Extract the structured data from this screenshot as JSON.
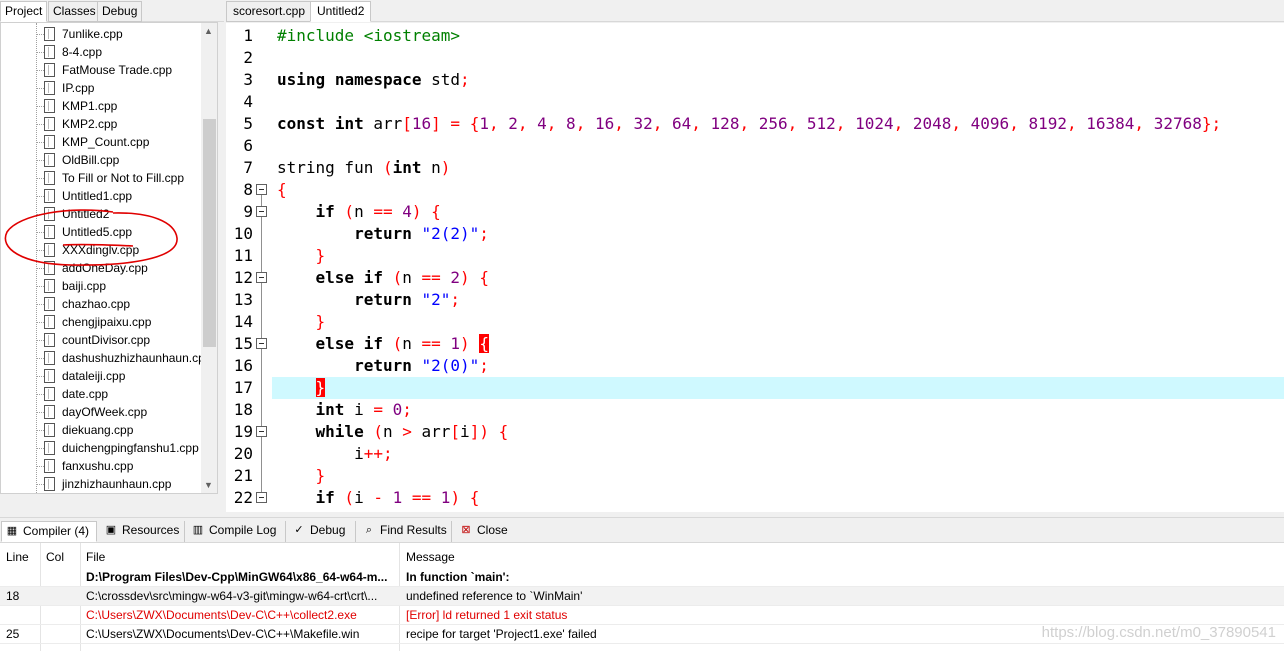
{
  "left_tabs": [
    "Project",
    "Classes",
    "Debug"
  ],
  "files": [
    "7unlike.cpp",
    "8-4.cpp",
    "FatMouse Trade.cpp",
    "IP.cpp",
    "KMP1.cpp",
    "KMP2.cpp",
    "KMP_Count.cpp",
    "OldBill.cpp",
    "To Fill or Not to Fill.cpp",
    "Untitled1.cpp",
    "Untitled2",
    "Untitled5.cpp",
    "XXXdinglv.cpp",
    "addOneDay.cpp",
    "baiji.cpp",
    "chazhao.cpp",
    "chengjipaixu.cpp",
    "countDivisor.cpp",
    "dashushuzhizhaunhaun.cpp",
    "dataleiji.cpp",
    "date.cpp",
    "dayOfWeek.cpp",
    "diekuang.cpp",
    "duichengpingfanshu1.cpp",
    "fanxushu.cpp",
    "jinzhizhaunhaun.cpp"
  ],
  "editor_tabs": [
    "scoresort.cpp",
    "Untitled2"
  ],
  "line_numbers": [
    "1",
    "2",
    "3",
    "4",
    "5",
    "6",
    "7",
    "8",
    "9",
    "10",
    "11",
    "12",
    "13",
    "14",
    "15",
    "16",
    "17",
    "18",
    "19",
    "20",
    "21",
    "22"
  ],
  "code_lines": [
    [
      {
        "t": "#include <iostream>",
        "c": "pp"
      }
    ],
    [],
    [
      {
        "t": "using",
        "c": "kw"
      },
      {
        "t": " ",
        "c": "id"
      },
      {
        "t": "namespace",
        "c": "kw"
      },
      {
        "t": " std",
        "c": "id"
      },
      {
        "t": ";",
        "c": "sym"
      }
    ],
    [],
    [
      {
        "t": "const",
        "c": "kw"
      },
      {
        "t": " ",
        "c": "id"
      },
      {
        "t": "int",
        "c": "kw"
      },
      {
        "t": " arr",
        "c": "id"
      },
      {
        "t": "[",
        "c": "sym"
      },
      {
        "t": "16",
        "c": "num"
      },
      {
        "t": "] = {",
        "c": "sym"
      },
      {
        "t": "1",
        "c": "num"
      },
      {
        "t": ", ",
        "c": "sym"
      },
      {
        "t": "2",
        "c": "num"
      },
      {
        "t": ", ",
        "c": "sym"
      },
      {
        "t": "4",
        "c": "num"
      },
      {
        "t": ", ",
        "c": "sym"
      },
      {
        "t": "8",
        "c": "num"
      },
      {
        "t": ", ",
        "c": "sym"
      },
      {
        "t": "16",
        "c": "num"
      },
      {
        "t": ", ",
        "c": "sym"
      },
      {
        "t": "32",
        "c": "num"
      },
      {
        "t": ", ",
        "c": "sym"
      },
      {
        "t": "64",
        "c": "num"
      },
      {
        "t": ", ",
        "c": "sym"
      },
      {
        "t": "128",
        "c": "num"
      },
      {
        "t": ", ",
        "c": "sym"
      },
      {
        "t": "256",
        "c": "num"
      },
      {
        "t": ", ",
        "c": "sym"
      },
      {
        "t": "512",
        "c": "num"
      },
      {
        "t": ", ",
        "c": "sym"
      },
      {
        "t": "1024",
        "c": "num"
      },
      {
        "t": ", ",
        "c": "sym"
      },
      {
        "t": "2048",
        "c": "num"
      },
      {
        "t": ", ",
        "c": "sym"
      },
      {
        "t": "4096",
        "c": "num"
      },
      {
        "t": ", ",
        "c": "sym"
      },
      {
        "t": "8192",
        "c": "num"
      },
      {
        "t": ", ",
        "c": "sym"
      },
      {
        "t": "16384",
        "c": "num"
      },
      {
        "t": ", ",
        "c": "sym"
      },
      {
        "t": "32768",
        "c": "num"
      },
      {
        "t": "};",
        "c": "sym"
      }
    ],
    [],
    [
      {
        "t": "string fun ",
        "c": "id"
      },
      {
        "t": "(",
        "c": "sym"
      },
      {
        "t": "int",
        "c": "kw"
      },
      {
        "t": " n",
        "c": "id"
      },
      {
        "t": ")",
        "c": "sym"
      }
    ],
    [
      {
        "t": "{",
        "c": "sym"
      }
    ],
    [
      {
        "t": "    ",
        "c": "id"
      },
      {
        "t": "if",
        "c": "kw"
      },
      {
        "t": " (",
        "c": "sym"
      },
      {
        "t": "n ",
        "c": "id"
      },
      {
        "t": "==",
        "c": "sym"
      },
      {
        "t": " ",
        "c": "id"
      },
      {
        "t": "4",
        "c": "num"
      },
      {
        "t": ") {",
        "c": "sym"
      }
    ],
    [
      {
        "t": "        ",
        "c": "id"
      },
      {
        "t": "return",
        "c": "kw"
      },
      {
        "t": " ",
        "c": "id"
      },
      {
        "t": "\"2(2)\"",
        "c": "str"
      },
      {
        "t": ";",
        "c": "sym"
      }
    ],
    [
      {
        "t": "    ",
        "c": "id"
      },
      {
        "t": "}",
        "c": "sym"
      }
    ],
    [
      {
        "t": "    ",
        "c": "id"
      },
      {
        "t": "else",
        "c": "kw"
      },
      {
        "t": " ",
        "c": "id"
      },
      {
        "t": "if",
        "c": "kw"
      },
      {
        "t": " (",
        "c": "sym"
      },
      {
        "t": "n ",
        "c": "id"
      },
      {
        "t": "==",
        "c": "sym"
      },
      {
        "t": " ",
        "c": "id"
      },
      {
        "t": "2",
        "c": "num"
      },
      {
        "t": ") {",
        "c": "sym"
      }
    ],
    [
      {
        "t": "        ",
        "c": "id"
      },
      {
        "t": "return",
        "c": "kw"
      },
      {
        "t": " ",
        "c": "id"
      },
      {
        "t": "\"2\"",
        "c": "str"
      },
      {
        "t": ";",
        "c": "sym"
      }
    ],
    [
      {
        "t": "    ",
        "c": "id"
      },
      {
        "t": "}",
        "c": "sym"
      }
    ],
    [
      {
        "t": "    ",
        "c": "id"
      },
      {
        "t": "else",
        "c": "kw"
      },
      {
        "t": " ",
        "c": "id"
      },
      {
        "t": "if",
        "c": "kw"
      },
      {
        "t": " (",
        "c": "sym"
      },
      {
        "t": "n ",
        "c": "id"
      },
      {
        "t": "==",
        "c": "sym"
      },
      {
        "t": " ",
        "c": "id"
      },
      {
        "t": "1",
        "c": "num"
      },
      {
        "t": ") ",
        "c": "sym"
      },
      {
        "t": "{",
        "c": "bm"
      }
    ],
    [
      {
        "t": "        ",
        "c": "id"
      },
      {
        "t": "return",
        "c": "kw"
      },
      {
        "t": " ",
        "c": "id"
      },
      {
        "t": "\"2(0)\"",
        "c": "str"
      },
      {
        "t": ";",
        "c": "sym"
      }
    ],
    [
      {
        "t": "    ",
        "c": "id"
      },
      {
        "t": "}",
        "c": "bm"
      }
    ],
    [
      {
        "t": "    ",
        "c": "id"
      },
      {
        "t": "int",
        "c": "kw"
      },
      {
        "t": " i ",
        "c": "id"
      },
      {
        "t": "=",
        "c": "sym"
      },
      {
        "t": " ",
        "c": "id"
      },
      {
        "t": "0",
        "c": "num"
      },
      {
        "t": ";",
        "c": "sym"
      }
    ],
    [
      {
        "t": "    ",
        "c": "id"
      },
      {
        "t": "while",
        "c": "kw"
      },
      {
        "t": " (",
        "c": "sym"
      },
      {
        "t": "n ",
        "c": "id"
      },
      {
        "t": ">",
        "c": "sym"
      },
      {
        "t": " arr",
        "c": "id"
      },
      {
        "t": "[",
        "c": "sym"
      },
      {
        "t": "i",
        "c": "id"
      },
      {
        "t": "]) {",
        "c": "sym"
      }
    ],
    [
      {
        "t": "        i",
        "c": "id"
      },
      {
        "t": "++;",
        "c": "sym"
      }
    ],
    [
      {
        "t": "    ",
        "c": "id"
      },
      {
        "t": "}",
        "c": "sym"
      }
    ],
    [
      {
        "t": "    ",
        "c": "id"
      },
      {
        "t": "if",
        "c": "kw"
      },
      {
        "t": " (",
        "c": "sym"
      },
      {
        "t": "i ",
        "c": "id"
      },
      {
        "t": "-",
        "c": "sym"
      },
      {
        "t": " ",
        "c": "id"
      },
      {
        "t": "1",
        "c": "num"
      },
      {
        "t": " ",
        "c": "id"
      },
      {
        "t": "==",
        "c": "sym"
      },
      {
        "t": " ",
        "c": "id"
      },
      {
        "t": "1",
        "c": "num"
      },
      {
        "t": ") {",
        "c": "sym"
      }
    ]
  ],
  "current_line": 17,
  "fold_lines": [
    8,
    9,
    12,
    15,
    19,
    22
  ],
  "bottom_tabs": [
    {
      "label": "Compiler (4)",
      "icon": "compiler-grid-icon"
    },
    {
      "label": "Resources",
      "icon": "resources-icon"
    },
    {
      "label": "Compile Log",
      "icon": "compile-log-icon"
    },
    {
      "label": "Debug",
      "icon": "debug-icon"
    },
    {
      "label": "Find Results",
      "icon": "find-results-icon"
    },
    {
      "label": "Close",
      "icon": "close-icon"
    }
  ],
  "table": {
    "headers": {
      "line": "Line",
      "col": "Col",
      "file": "File",
      "message": "Message"
    },
    "rows": [
      {
        "line": "",
        "col": "",
        "file": "D:\\Program Files\\Dev-Cpp\\MinGW64\\x86_64-w64-m...",
        "message": "In function `main':",
        "style": "bold"
      },
      {
        "line": "18",
        "col": "",
        "file": "C:\\crossdev\\src\\mingw-w64-v3-git\\mingw-w64-crt\\crt\\...",
        "message": "undefined reference to `WinMain'",
        "style": "selected"
      },
      {
        "line": "",
        "col": "",
        "file": "C:\\Users\\ZWX\\Documents\\Dev-C\\C++\\collect2.exe",
        "message": "[Error] ld returned 1 exit status",
        "style": "error"
      },
      {
        "line": "25",
        "col": "",
        "file": "C:\\Users\\ZWX\\Documents\\Dev-C\\C++\\Makefile.win",
        "message": "recipe for target 'Project1.exe' failed",
        "style": "normal"
      }
    ]
  },
  "watermark": "https://blog.csdn.net/m0_37890541",
  "colors": {
    "current_line_bg": "#cff9ff",
    "error_text": "#e00000",
    "selected_row_bg": "#f2f2f2",
    "annotation": "#e00000"
  }
}
